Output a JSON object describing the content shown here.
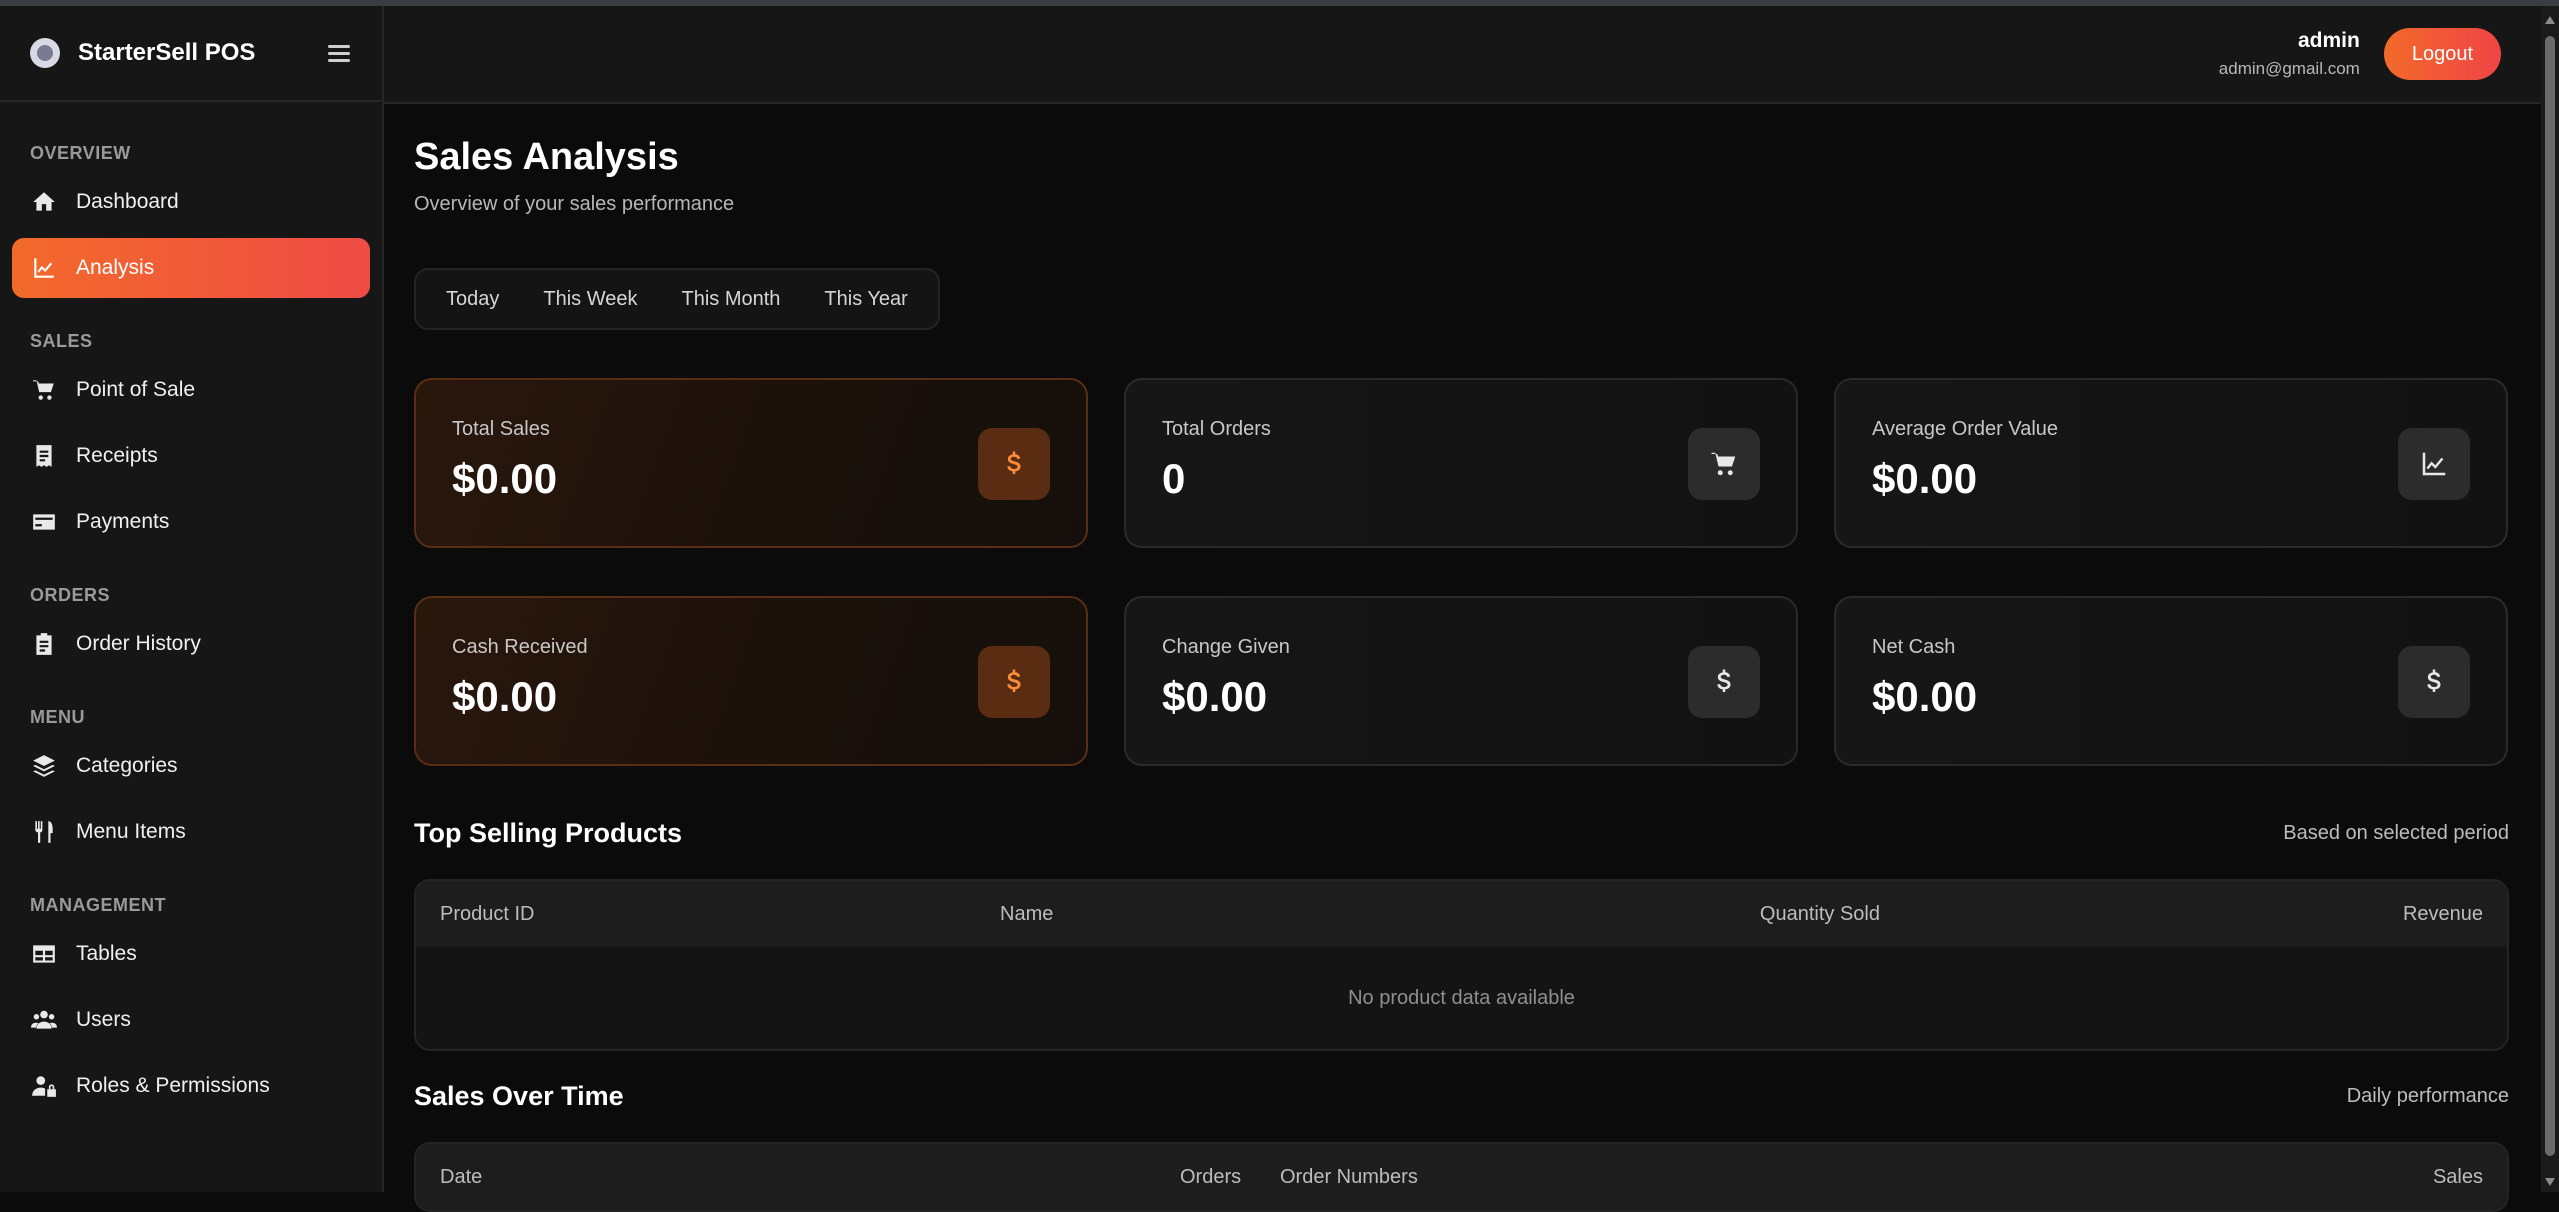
{
  "brand": {
    "name": "StarterSell POS"
  },
  "sidebar": {
    "sections": [
      {
        "title": "OVERVIEW",
        "items": [
          {
            "label": "Dashboard",
            "icon": "home-icon"
          },
          {
            "label": "Analysis",
            "icon": "chart-line-icon",
            "active": true
          }
        ]
      },
      {
        "title": "SALES",
        "items": [
          {
            "label": "Point of Sale",
            "icon": "cart-icon"
          },
          {
            "label": "Receipts",
            "icon": "receipt-icon"
          },
          {
            "label": "Payments",
            "icon": "credit-card-icon"
          }
        ]
      },
      {
        "title": "ORDERS",
        "items": [
          {
            "label": "Order History",
            "icon": "clipboard-icon"
          }
        ]
      },
      {
        "title": "MENU",
        "items": [
          {
            "label": "Categories",
            "icon": "layers-icon"
          },
          {
            "label": "Menu Items",
            "icon": "utensils-icon"
          }
        ]
      },
      {
        "title": "MANAGEMENT",
        "items": [
          {
            "label": "Tables",
            "icon": "table-icon"
          },
          {
            "label": "Users",
            "icon": "users-icon"
          },
          {
            "label": "Roles & Permissions",
            "icon": "user-lock-icon"
          }
        ]
      }
    ]
  },
  "header": {
    "user_name": "admin",
    "user_email": "admin@gmail.com",
    "logout_label": "Logout"
  },
  "page": {
    "title": "Sales Analysis",
    "subtitle": "Overview of your sales performance"
  },
  "range_tabs": [
    "Today",
    "This Week",
    "This Month",
    "This Year"
  ],
  "cards": [
    {
      "label": "Total Sales",
      "value": "$0.00",
      "icon": "dollar-icon",
      "accent": true
    },
    {
      "label": "Total Orders",
      "value": "0",
      "icon": "cart-icon",
      "accent": false
    },
    {
      "label": "Average Order Value",
      "value": "$0.00",
      "icon": "chart-line-icon",
      "accent": false
    },
    {
      "label": "Cash Received",
      "value": "$0.00",
      "icon": "dollar-icon",
      "accent": true
    },
    {
      "label": "Change Given",
      "value": "$0.00",
      "icon": "dollar-icon",
      "accent": false
    },
    {
      "label": "Net Cash",
      "value": "$0.00",
      "icon": "dollar-icon",
      "accent": false
    }
  ],
  "top_products": {
    "title": "Top Selling Products",
    "aside": "Based on selected period",
    "columns": [
      "Product ID",
      "Name",
      "Quantity Sold",
      "Revenue"
    ],
    "empty_text": "No product data available"
  },
  "sales_over_time": {
    "title": "Sales Over Time",
    "aside": "Daily performance",
    "columns": [
      "Date",
      "Orders",
      "Order Numbers",
      "Sales"
    ]
  },
  "colors": {
    "accent_start": "#f26a2b",
    "accent_end": "#ef4444",
    "accent_icon": "#ff8c3a",
    "background": "#0b0b0b",
    "panel": "#161616"
  }
}
